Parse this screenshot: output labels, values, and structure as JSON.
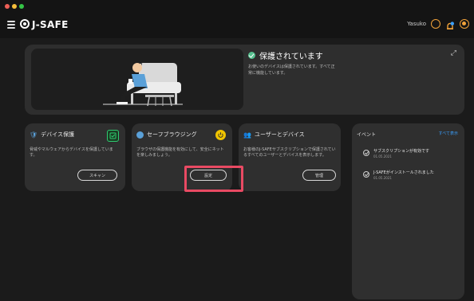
{
  "app": {
    "brand": "J-SAFE",
    "user_name": "Yasuko",
    "colors": {
      "accent": "#f0a23a",
      "success": "#56c08f",
      "highlight": "#e94a63",
      "link": "#3aa0ff"
    }
  },
  "icons": {
    "menu": "hamburger-icon",
    "profile": "user-icon",
    "notifications": "bell-icon",
    "power": "power-icon",
    "expand": "expand-icon"
  },
  "hero": {
    "status": "保護されています",
    "description": "お使いのデバイスは保護されています。すべて正常に機能しています。"
  },
  "cards": [
    {
      "title": "デバイス保護",
      "badge_icon": "check-icon",
      "badge_color": "#28a745",
      "description": "脅威やマルウェアからデバイスを保護しています。",
      "button": "スキャン"
    },
    {
      "title": "セーフブラウジング",
      "badge_icon": "power-icon",
      "badge_color": "#f0c400",
      "description": "ブラウザの保護機能を有効にして、安全にネットを楽しみましょう。",
      "button": "設定"
    },
    {
      "title": "ユーザーとデバイス",
      "badge_icon": null,
      "badge_color": null,
      "description": "お客様のJ-SAFEサブスクリプションで保護されているすべてのユーザーとデバイスを表示します。",
      "button": "管理"
    }
  ],
  "events": {
    "header": "イベント",
    "view_all": "すべて表示",
    "items": [
      {
        "title": "サブスクリプションが有効です",
        "date": "01.05.2021"
      },
      {
        "title": "J-SAFEがインストールされました",
        "date": "01.05.2021"
      }
    ]
  }
}
